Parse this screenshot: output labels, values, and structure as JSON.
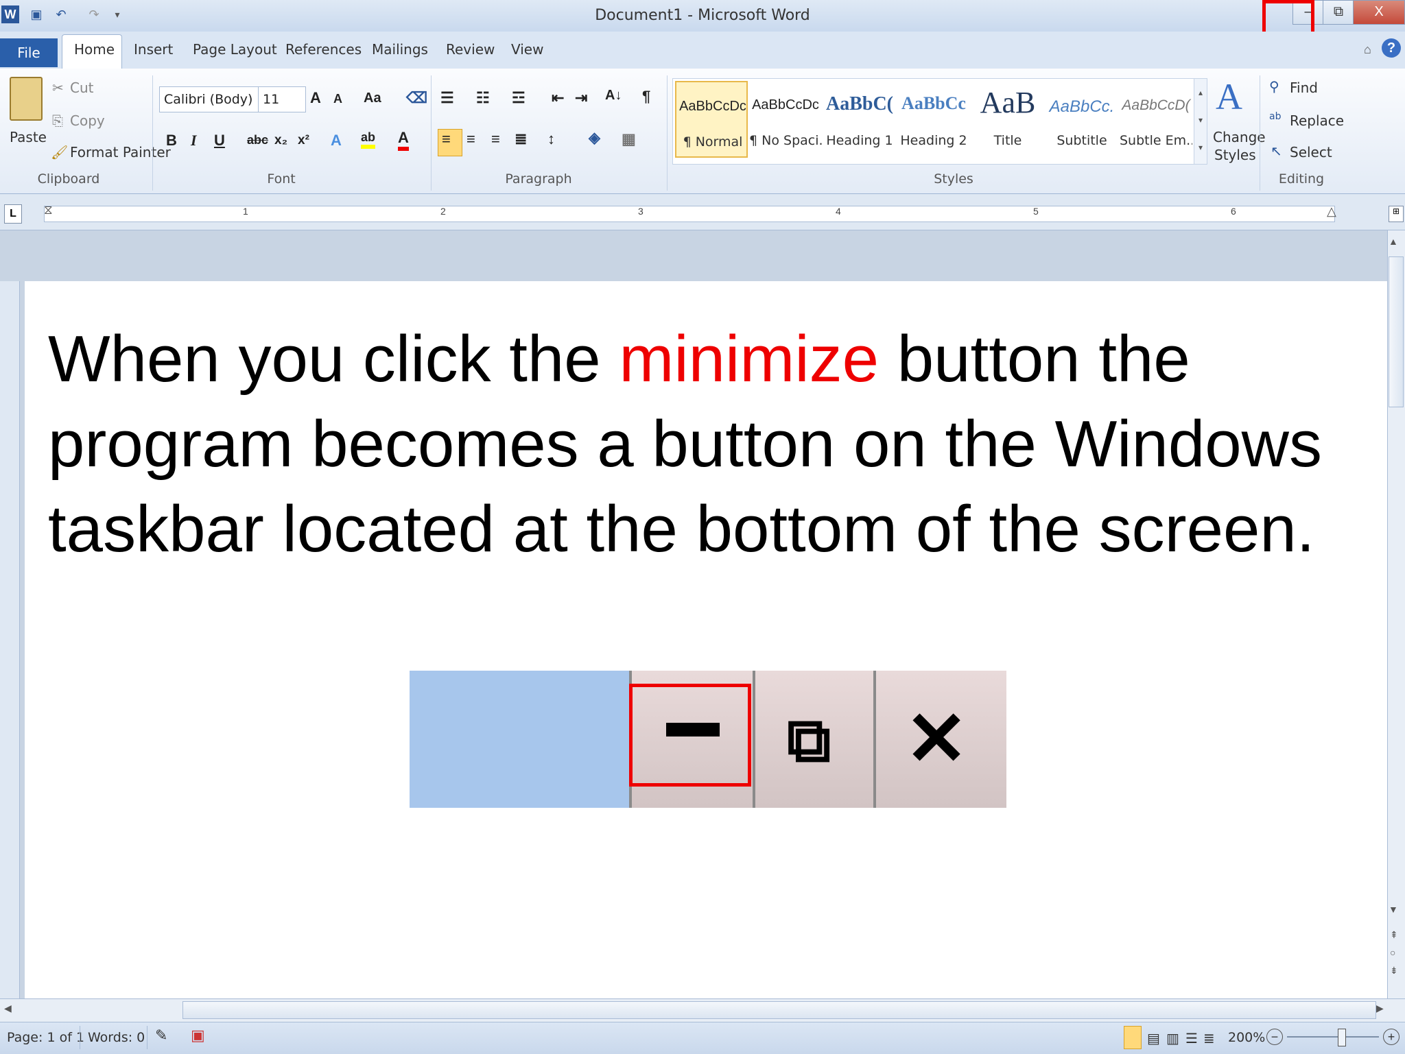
{
  "window": {
    "title": "Document1 - Microsoft Word",
    "min_label": "–",
    "restore_label": "⧉",
    "close_label": "X"
  },
  "qat": {
    "word_icon": "W",
    "save_icon": "💾",
    "undo_icon": "↶",
    "redo_icon": "↷"
  },
  "tabs": {
    "file": "File",
    "items": [
      "Home",
      "Insert",
      "Page Layout",
      "References",
      "Mailings",
      "Review",
      "View"
    ]
  },
  "clipboard": {
    "paste": "Paste",
    "cut": "Cut",
    "copy": "Copy",
    "format_painter": "Format Painter",
    "group": "Clipboard"
  },
  "font": {
    "name": "Calibri (Body)",
    "size": "11",
    "grow": "A",
    "shrink": "A",
    "change_case": "Aa",
    "bold": "B",
    "italic": "I",
    "underline": "U",
    "strike": "abc",
    "subscript": "x₂",
    "superscript": "x²",
    "text_effects": "A",
    "highlight": "ab",
    "font_color": "A",
    "group": "Font"
  },
  "paragraph": {
    "pilcrow": "¶",
    "sort": "A↓",
    "group": "Paragraph"
  },
  "styles": {
    "items": [
      {
        "sample": "AaBbCcDc",
        "name": "¶ Normal"
      },
      {
        "sample": "AaBbCcDc",
        "name": "¶ No Spaci..."
      },
      {
        "sample": "AaBbC(",
        "name": "Heading 1"
      },
      {
        "sample": "AaBbCc",
        "name": "Heading 2"
      },
      {
        "sample": "AaB",
        "name": "Title"
      },
      {
        "sample": "AaBbCc.",
        "name": "Subtitle"
      },
      {
        "sample": "AaBbCcD(",
        "name": "Subtle Em..."
      }
    ],
    "change_styles_1": "Change",
    "change_styles_2": "Styles",
    "group": "Styles"
  },
  "editing": {
    "find": "Find",
    "replace": "Replace",
    "select": "Select",
    "group": "Editing"
  },
  "ruler": {
    "tab_selector": "L",
    "numbers": [
      "1",
      "2",
      "3",
      "4",
      "5",
      "6"
    ]
  },
  "document": {
    "text_before": "When you click the ",
    "text_highlight": "minimize",
    "text_after": " button the program becomes a button on the Windows taskbar located at the bottom of the screen."
  },
  "zoom_image": {
    "min_glyph": "_",
    "restore_glyph": "⧉",
    "close_glyph": "✕"
  },
  "status": {
    "page": "Page: 1 of 1",
    "words": "Words: 0",
    "zoom": "200%"
  },
  "colors": {
    "highlight": "#e00000",
    "file_tab": "#2a5faa"
  }
}
